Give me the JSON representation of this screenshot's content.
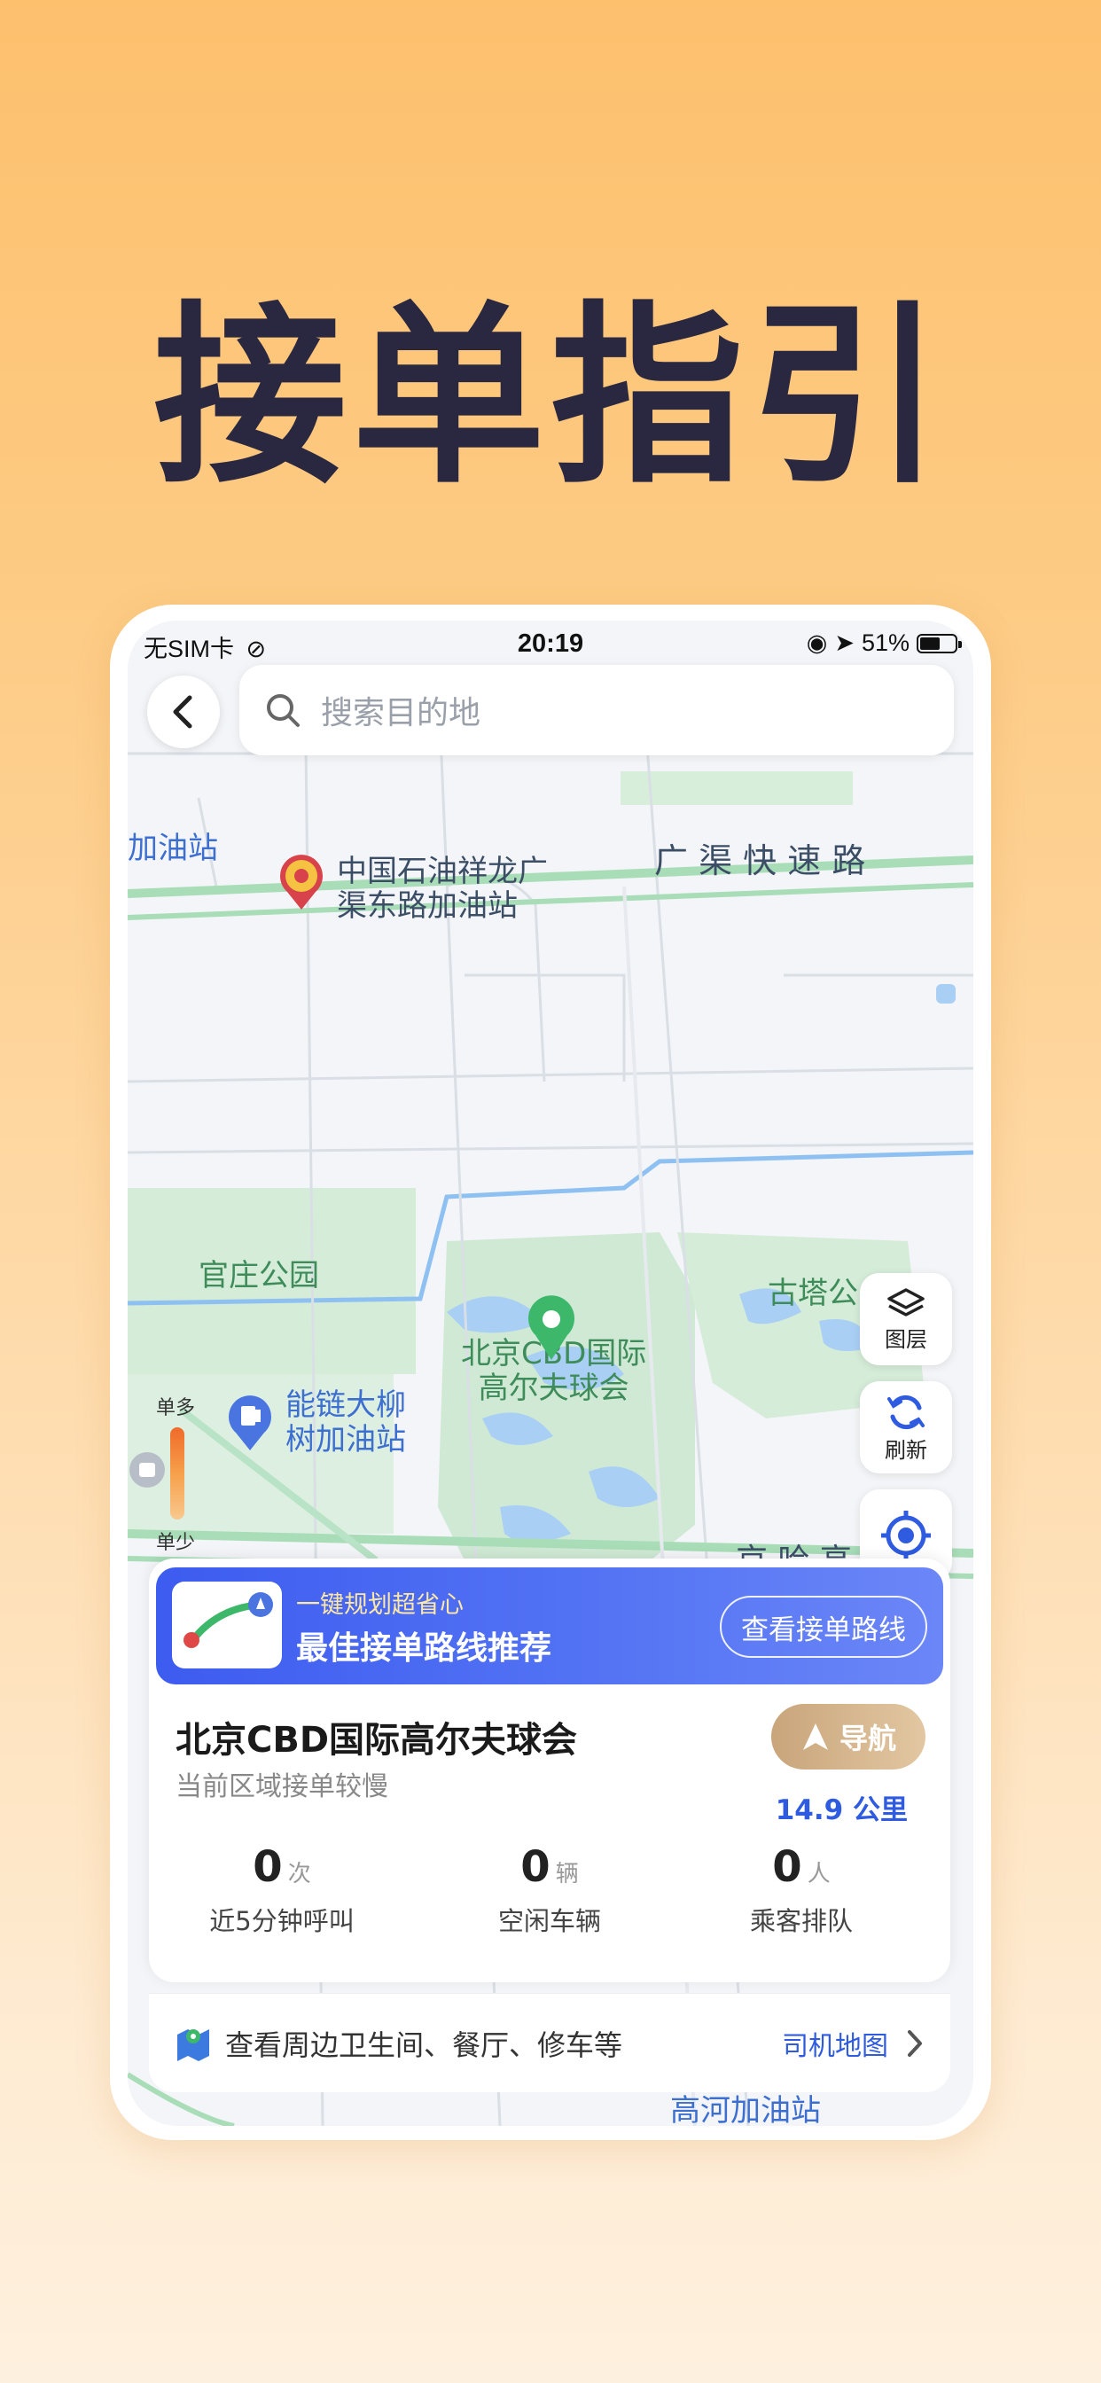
{
  "headline": "接单指引",
  "status_bar": {
    "carrier": "无SIM卡",
    "time": "20:19",
    "battery": "51%"
  },
  "search": {
    "placeholder": "搜索目的地"
  },
  "map_labels": {
    "gas_station_left": "加油站",
    "sinopec_station_line1": "中国石油祥龙广",
    "sinopec_station_line2": "渠东路加油站",
    "road_guangqu": "广 渠 快 速 路",
    "park_guanzhuang": "官庄公园",
    "golf_line1": "北京CBD国际",
    "golf_line2": "高尔夫球会",
    "gutai_park": "古塔公",
    "station_liushu_line1": "能链大柳",
    "station_liushu_line2": "树加油站",
    "road_jingha": "京 哈 高 速",
    "bottom_station": "高河加油站"
  },
  "heat_legend": {
    "top": "单多",
    "bottom": "单少"
  },
  "side_buttons": {
    "layers": "图层",
    "refresh": "刷新"
  },
  "banner": {
    "subtitle": "一键规划超省心",
    "title": "最佳接单路线推荐",
    "button": "查看接单路线"
  },
  "place": {
    "name": "北京CBD国际高尔夫球会",
    "note": "当前区域接单较慢",
    "nav_button": "导航",
    "distance": "14.9 公里"
  },
  "stats": [
    {
      "value": "0",
      "unit": "次",
      "label": "近5分钟呼叫"
    },
    {
      "value": "0",
      "unit": "辆",
      "label": "空闲车辆"
    },
    {
      "value": "0",
      "unit": "人",
      "label": "乘客排队"
    }
  ],
  "bottom_bar": {
    "text": "查看周边卫生间、餐厅、修车等",
    "link": "司机地图"
  },
  "colors": {
    "brand_blue": "#3D5CF0",
    "nav_gold": "#C9A57B",
    "headline": "#2A2840"
  }
}
